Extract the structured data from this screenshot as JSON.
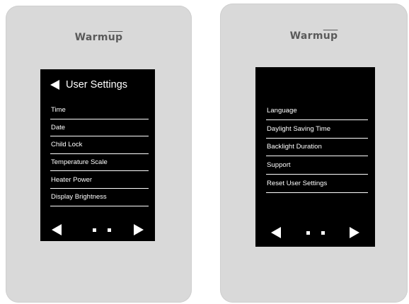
{
  "left_device": {
    "brand": {
      "prefix": "Warm",
      "suffix": "up"
    },
    "screen": {
      "title": "User Settings",
      "back_icon": "back-triangle-icon",
      "menu": [
        {
          "label": "Time"
        },
        {
          "label": "Date"
        },
        {
          "label": "Child Lock"
        },
        {
          "label": "Temperature Scale"
        },
        {
          "label": "Heater Power"
        },
        {
          "label": "Display Brightness"
        }
      ],
      "pager": {
        "prev_icon": "prev-triangle-icon",
        "next_icon": "next-triangle-icon",
        "dots": 2
      }
    }
  },
  "right_device": {
    "brand": {
      "prefix": "Warm",
      "suffix": "up"
    },
    "screen": {
      "menu": [
        {
          "label": "Language"
        },
        {
          "label": "Daylight Saving Time"
        },
        {
          "label": "Backlight Duration"
        },
        {
          "label": "Support"
        },
        {
          "label": "Reset User Settings"
        }
      ],
      "pager": {
        "prev_icon": "prev-triangle-icon",
        "next_icon": "next-triangle-icon",
        "dots": 2
      }
    }
  },
  "colors": {
    "device_body": "#d9d9d9",
    "screen": "#000000",
    "screen_text": "#ffffff",
    "brand_text": "#5a5a5a"
  }
}
